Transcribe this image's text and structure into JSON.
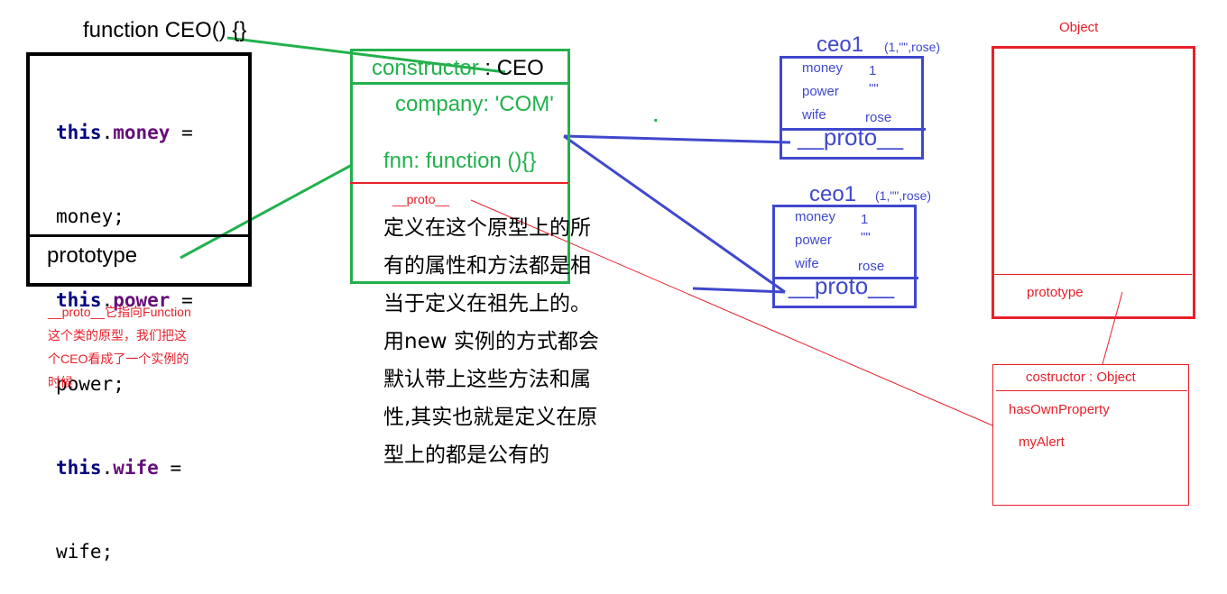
{
  "ceo_function": {
    "title": "function  CEO() {}",
    "body_lines": [
      {
        "kw": "this",
        "prop": "money",
        "rest": " ="
      },
      {
        "plain": "money;"
      },
      {
        "kw": "this",
        "prop": "power",
        "rest": " ="
      },
      {
        "plain": "power;"
      },
      {
        "kw": "this",
        "prop": "wife",
        "rest": " ="
      },
      {
        "plain": "wife;"
      }
    ],
    "prototype_label": "prototype"
  },
  "proto_note": "__proto__它指向Function这个类的原型，我们把这个CEO看成了一个实例的时候",
  "ceo_prototype": {
    "constructor_key": "constructor",
    "constructor_value": " : CEO",
    "company": "company: 'COM'",
    "fnn": "fnn: function (){}",
    "proto_label": "__proto__",
    "dot": ".",
    "description": "定义在这个原型上的所有的属性和方法都是相当于定义在祖先上的。用new 实例的方式都会默认带上这些方法和属性,其实也就是定义在原型上的都是公有的"
  },
  "instances": [
    {
      "name": "ceo1",
      "args": "(1,\"\",rose)",
      "fields": [
        {
          "key": "money",
          "value": "1"
        },
        {
          "key": "power",
          "value": "\"\""
        },
        {
          "key": "wife",
          "value": "rose"
        }
      ],
      "proto_label": "__proto__"
    },
    {
      "name": "ceo1",
      "args": "(1,\"\",rose)",
      "fields": [
        {
          "key": "money",
          "value": "1"
        },
        {
          "key": "power",
          "value": "\"\""
        },
        {
          "key": "wife",
          "value": "rose"
        }
      ],
      "proto_label": "__proto__"
    }
  ],
  "object": {
    "title": "Object",
    "prototype_label": "prototype",
    "proto_constructor": "costructor : Object",
    "methods": [
      "hasOwnProperty",
      "myAlert"
    ]
  },
  "colors": {
    "green": "#22b14c",
    "blue": "#3f48cc",
    "red": "#e8202a",
    "black": "#000000"
  }
}
